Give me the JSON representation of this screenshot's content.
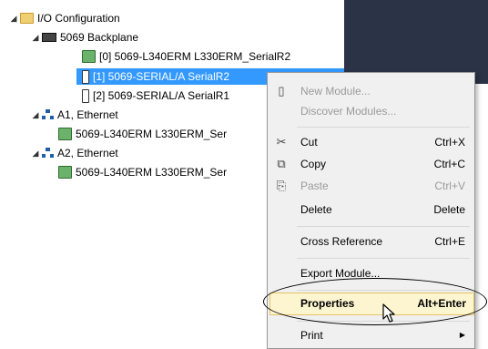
{
  "tree": {
    "top_label": "I/O Configuration",
    "partial_label": "",
    "items": [
      {
        "label": "I/O Configuration"
      },
      {
        "label": "5069 Backplane"
      },
      {
        "label": "[0] 5069-L340ERM L330ERM_SerialR2"
      },
      {
        "label": "[1] 5069-SERIAL/A SerialR2"
      },
      {
        "label": "[2] 5069-SERIAL/A SerialR1"
      },
      {
        "label": "A1, Ethernet"
      },
      {
        "label": "5069-L340ERM L330ERM_Ser"
      },
      {
        "label": "A2, Ethernet"
      },
      {
        "label": "5069-L340ERM L330ERM_Ser"
      }
    ]
  },
  "menu": {
    "items": [
      {
        "label": "New Module...",
        "shortcut": "",
        "icon": "new-module-icon"
      },
      {
        "label": "Discover Modules...",
        "shortcut": "",
        "icon": ""
      },
      {
        "label": "Cut",
        "shortcut": "Ctrl+X",
        "icon": "scissors-icon"
      },
      {
        "label": "Copy",
        "shortcut": "Ctrl+C",
        "icon": "copy-icon"
      },
      {
        "label": "Paste",
        "shortcut": "Ctrl+V",
        "icon": "paste-icon"
      },
      {
        "label": "Delete",
        "shortcut": "Delete",
        "icon": ""
      },
      {
        "label": "Cross Reference",
        "shortcut": "Ctrl+E",
        "icon": ""
      },
      {
        "label": "Export Module...",
        "shortcut": "",
        "icon": ""
      },
      {
        "label": "Properties",
        "shortcut": "Alt+Enter",
        "icon": ""
      },
      {
        "label": "Print",
        "shortcut": "",
        "icon": ""
      }
    ]
  },
  "colors": {
    "selection": "#3399ff",
    "dark_pane": "#2b3347",
    "highlight_bg": "#fdf5cf",
    "highlight_border": "#e5c365"
  }
}
